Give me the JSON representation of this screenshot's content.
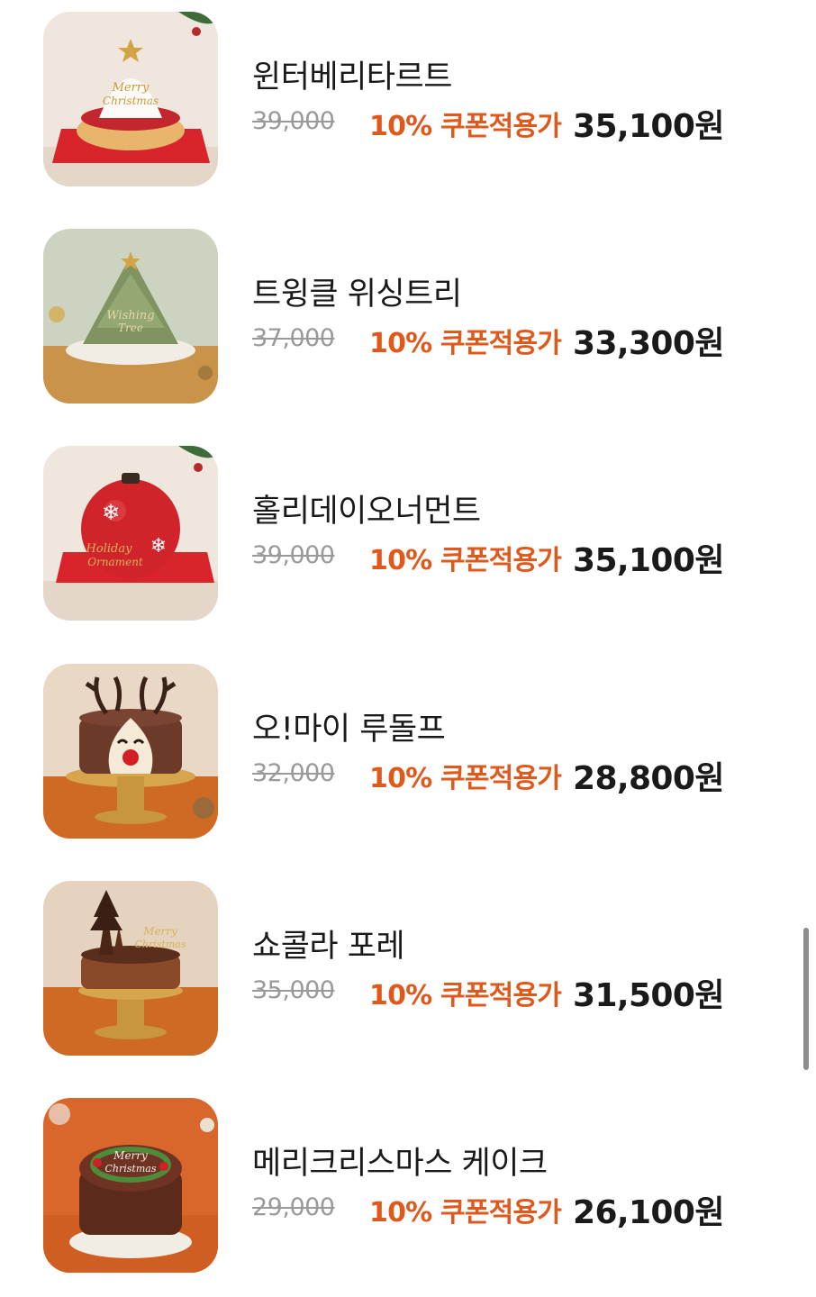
{
  "products": [
    {
      "name": "윈터베리타르트",
      "original_price": "39,000",
      "coupon_label": "10% 쿠폰적용가",
      "sale_price": "35,100원",
      "image_icon": "winterberry-tart-image"
    },
    {
      "name": "트윙클 위싱트리",
      "original_price": "37,000",
      "coupon_label": "10% 쿠폰적용가",
      "sale_price": "33,300원",
      "image_icon": "wishing-tree-cake-image"
    },
    {
      "name": "홀리데이오너먼트",
      "original_price": "39,000",
      "coupon_label": "10% 쿠폰적용가",
      "sale_price": "35,100원",
      "image_icon": "holiday-ornament-cake-image"
    },
    {
      "name": "오!마이 루돌프",
      "original_price": "32,000",
      "coupon_label": "10% 쿠폰적용가",
      "sale_price": "28,800원",
      "image_icon": "rudolph-cake-image"
    },
    {
      "name": "쇼콜라 포레",
      "original_price": "35,000",
      "coupon_label": "10% 쿠폰적용가",
      "sale_price": "31,500원",
      "image_icon": "chocolat-foret-cake-image"
    },
    {
      "name": "메리크리스마스 케이크",
      "original_price": "29,000",
      "coupon_label": "10% 쿠폰적용가",
      "sale_price": "26,100원",
      "image_icon": "merry-christmas-cake-image"
    }
  ],
  "colors": {
    "accent": "#e0591c",
    "text": "#1a1a1a",
    "muted": "#9a9a9a"
  }
}
